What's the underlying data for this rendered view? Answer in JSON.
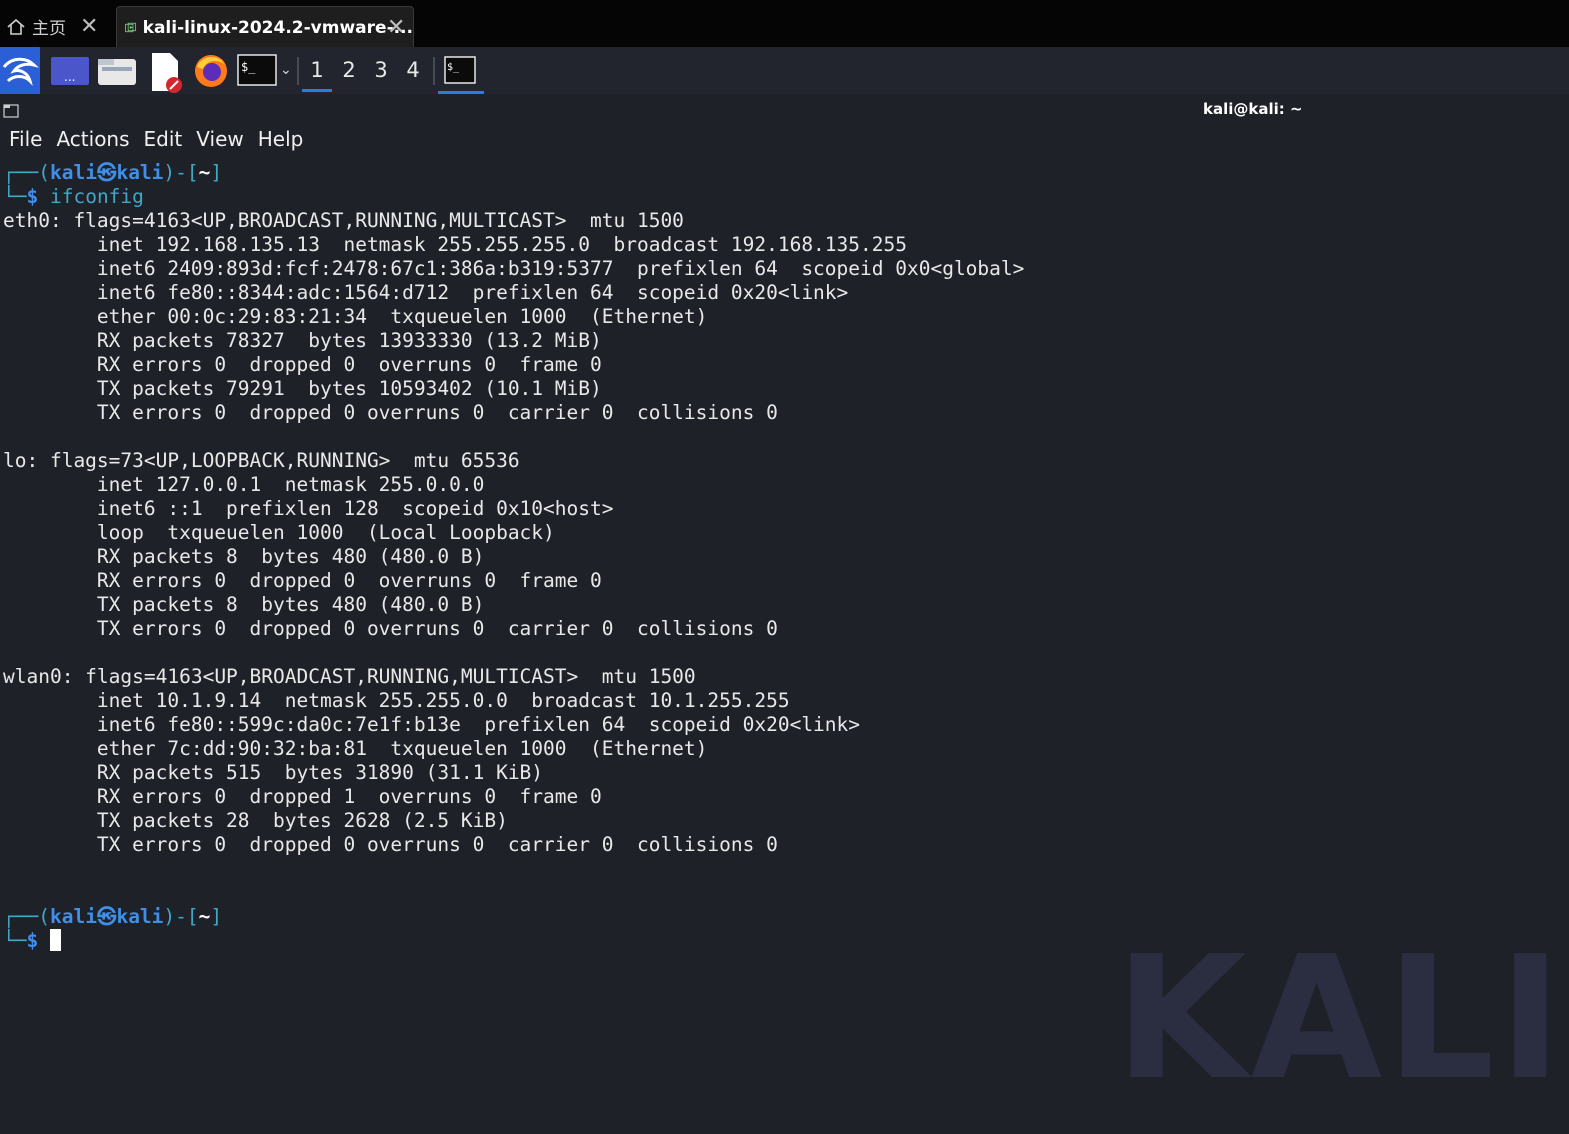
{
  "host_tabs": {
    "home_label": "主页",
    "vm_label": "kali-linux-2024.2-vmware-..."
  },
  "panel": {
    "workspaces": [
      "1",
      "2",
      "3",
      "4"
    ],
    "active_workspace": "1"
  },
  "window": {
    "title": "kali@kali: ~"
  },
  "menu": [
    "File",
    "Actions",
    "Edit",
    "View",
    "Help"
  ],
  "prompt": {
    "user": "kali",
    "host": "kali",
    "dir": "~",
    "symbol": "$"
  },
  "command": "ifconfig",
  "output": [
    "eth0: flags=4163<UP,BROADCAST,RUNNING,MULTICAST>  mtu 1500",
    "        inet 192.168.135.13  netmask 255.255.255.0  broadcast 192.168.135.255",
    "        inet6 2409:893d:fcf:2478:67c1:386a:b319:5377  prefixlen 64  scopeid 0x0<global>",
    "        inet6 fe80::8344:adc:1564:d712  prefixlen 64  scopeid 0x20<link>",
    "        ether 00:0c:29:83:21:34  txqueuelen 1000  (Ethernet)",
    "        RX packets 78327  bytes 13933330 (13.2 MiB)",
    "        RX errors 0  dropped 0  overruns 0  frame 0",
    "        TX packets 79291  bytes 10593402 (10.1 MiB)",
    "        TX errors 0  dropped 0 overruns 0  carrier 0  collisions 0",
    "",
    "lo: flags=73<UP,LOOPBACK,RUNNING>  mtu 65536",
    "        inet 127.0.0.1  netmask 255.0.0.0",
    "        inet6 ::1  prefixlen 128  scopeid 0x10<host>",
    "        loop  txqueuelen 1000  (Local Loopback)",
    "        RX packets 8  bytes 480 (480.0 B)",
    "        RX errors 0  dropped 0  overruns 0  frame 0",
    "        TX packets 8  bytes 480 (480.0 B)",
    "        TX errors 0  dropped 0 overruns 0  carrier 0  collisions 0",
    "",
    "wlan0: flags=4163<UP,BROADCAST,RUNNING,MULTICAST>  mtu 1500",
    "        inet 10.1.9.14  netmask 255.255.0.0  broadcast 10.1.255.255",
    "        inet6 fe80::599c:da0c:7e1f:b13e  prefixlen 64  scopeid 0x20<link>",
    "        ether 7c:dd:90:32:ba:81  txqueuelen 1000  (Ethernet)",
    "        RX packets 515  bytes 31890 (31.1 KiB)",
    "        RX errors 0  dropped 1  overruns 0  frame 0",
    "        TX packets 28  bytes 2628 (2.5 KiB)",
    "        TX errors 0  dropped 0 overruns 0  carrier 0  collisions 0"
  ],
  "wallpaper": {
    "text": "KALI"
  },
  "colors": {
    "prompt_blue": "#3f8fe8",
    "prompt_teal": "#3fa8c7",
    "background": "#1f2129"
  }
}
